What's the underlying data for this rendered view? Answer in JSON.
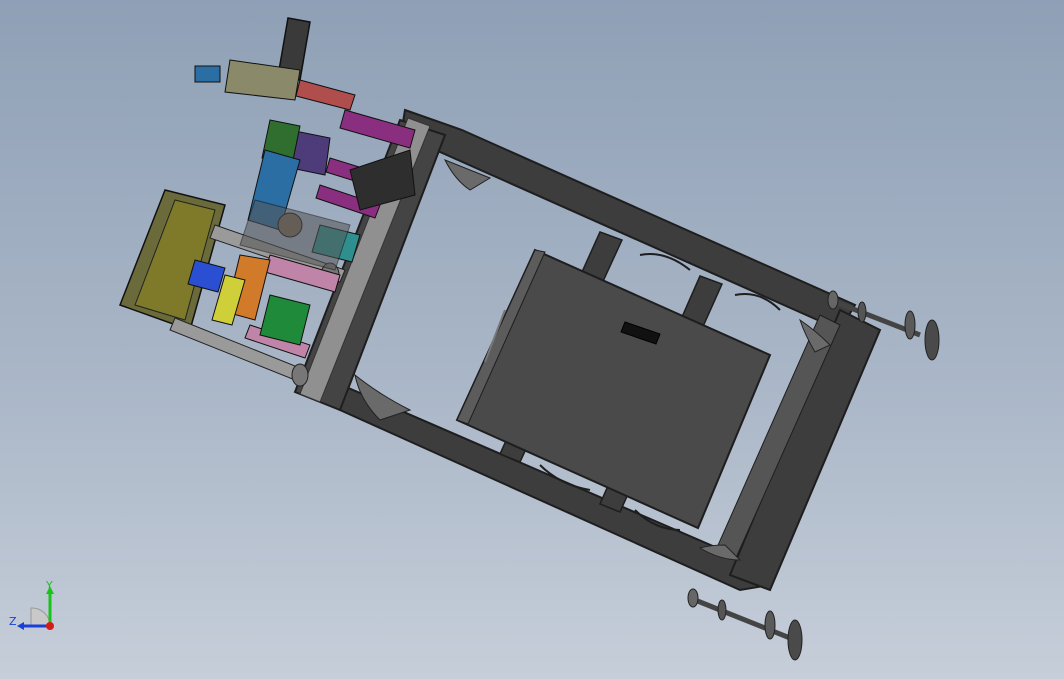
{
  "viewport": {
    "background_top": "#8fa0b6",
    "background_bottom": "#c6ced9"
  },
  "model": {
    "frame_color": "#3d3d3d",
    "frame_edge_color": "#1e1e1e",
    "panel_color": "#4a4a4a",
    "plate_color": "#909090",
    "mechanism_colors": [
      "#8a2f7f",
      "#2f6e2f",
      "#4d3b7a",
      "#2b6ea3",
      "#7e7a2a",
      "#b04d4d",
      "#1f8a3a",
      "#c084a8",
      "#2f8f8f",
      "#d07a2a"
    ]
  },
  "triad": {
    "y_label": "Y",
    "z_label": "Z",
    "y_color": "#19c319",
    "z_color": "#1a3fd6",
    "x_color": "#d61a1a"
  }
}
